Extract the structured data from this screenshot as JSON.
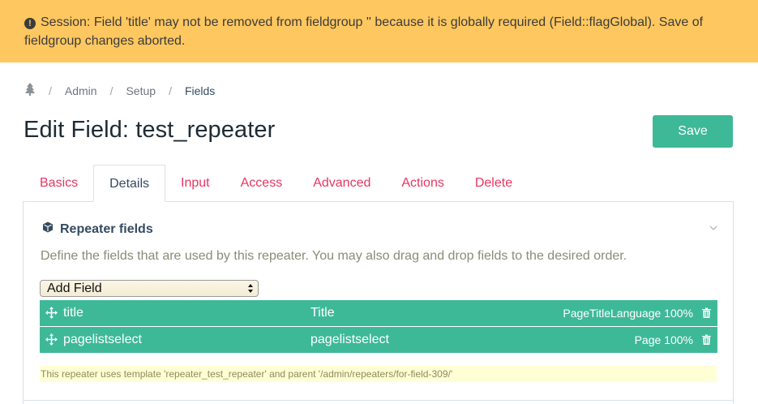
{
  "notice": {
    "icon": "exclamation-circle-icon",
    "message": "Session: Field 'title' may not be removed from fieldgroup '' because it is globally required (Field::flagGlobal). Save of fieldgroup changes aborted."
  },
  "breadcrumb": {
    "home_icon": "tree-icon",
    "items": [
      "Admin",
      "Setup"
    ],
    "current": "Fields"
  },
  "page_title": "Edit Field: test_repeater",
  "save_label": "Save",
  "tabs": [
    {
      "label": "Basics",
      "active": false
    },
    {
      "label": "Details",
      "active": true
    },
    {
      "label": "Input",
      "active": false
    },
    {
      "label": "Access",
      "active": false
    },
    {
      "label": "Advanced",
      "active": false
    },
    {
      "label": "Actions",
      "active": false
    },
    {
      "label": "Delete",
      "active": false
    }
  ],
  "section": {
    "icon": "cube-icon",
    "title": "Repeater fields",
    "description": "Define the fields that are used by this repeater. You may also drag and drop fields to the desired order.",
    "select_value": "Add Field",
    "rows": [
      {
        "name": "title",
        "label": "Title",
        "meta": "PageTitleLanguage 100%"
      },
      {
        "name": "pagelistselect",
        "label": "pagelistselect",
        "meta": "Page 100%"
      }
    ],
    "note": "This repeater uses template 'repeater_test_repeater' and parent '/admin/repeaters/for-field-309/'"
  },
  "colors": {
    "notice_bg": "#FFC75F",
    "accent_green": "#3eb998",
    "tab_link": "#e83561",
    "note_bg": "#ffffd5"
  }
}
